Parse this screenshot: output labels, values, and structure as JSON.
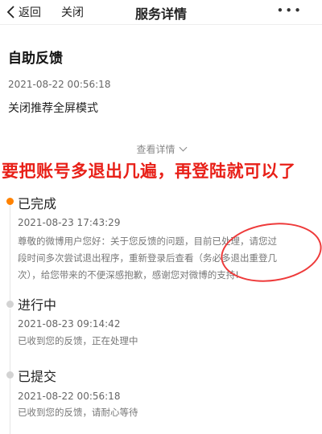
{
  "nav": {
    "back_label": "返回",
    "close_label": "关闭",
    "title": "服务详情",
    "more_label": "•••"
  },
  "feedback": {
    "title": "自助反馈",
    "time": "2021-08-22 00:56:18",
    "content": "关闭推荐全屏模式",
    "view_details_label": "查看详情"
  },
  "annotation": {
    "text": "要把账号多退出几遍，再登陆就可以了",
    "color": "#e82018"
  },
  "timeline": [
    {
      "status": "已完成",
      "time": "2021-08-23 17:43:29",
      "lines": [
        "尊敬的微博用户您好：关于您反馈的问题，目前已处理，请您过",
        "段时间多次尝试退出程序，重新登录后查看（务必多退出重登几",
        "次），给您带来的不便深感抱歉，感谢您对微博的支持!"
      ],
      "active": true
    },
    {
      "status": "进行中",
      "time": "2021-08-23 09:14:42",
      "lines": [
        "已收到您的反馈，正在处理中"
      ],
      "active": false
    },
    {
      "status": "已提交",
      "time": "2021-08-22 00:56:18",
      "lines": [
        "已收到您的反馈，请耐心等待"
      ],
      "active": false
    }
  ],
  "colors": {
    "accent": "#ff8200",
    "annotation_red": "#e82018"
  }
}
